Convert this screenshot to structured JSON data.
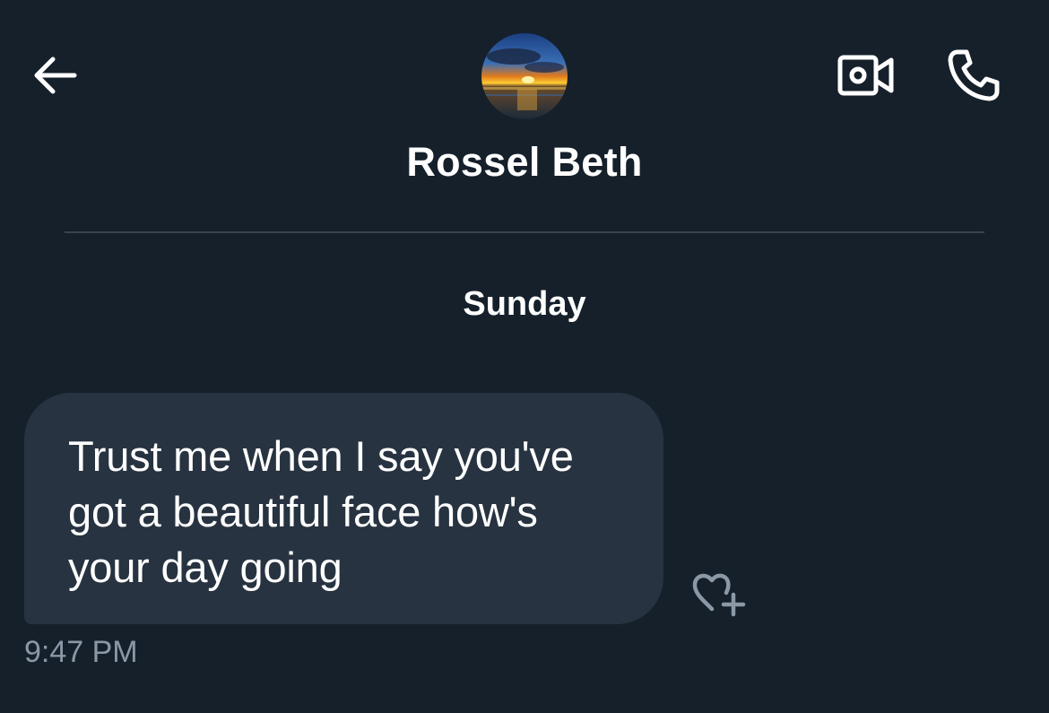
{
  "header": {
    "contact_name": "Rossel Beth",
    "back_icon": "arrow-left-icon",
    "video_icon": "video-call-icon",
    "call_icon": "phone-icon"
  },
  "conversation": {
    "day_label": "Sunday",
    "messages": [
      {
        "text": "Trust me when I say you've got a beautiful face how's your day going",
        "time": "9:47 PM",
        "reaction_icon": "heart-plus-icon"
      }
    ]
  },
  "colors": {
    "background": "#15202b",
    "bubble": "#273340",
    "divider": "#38444d",
    "muted_text": "#8b98a5",
    "icon": "#ffffff"
  }
}
